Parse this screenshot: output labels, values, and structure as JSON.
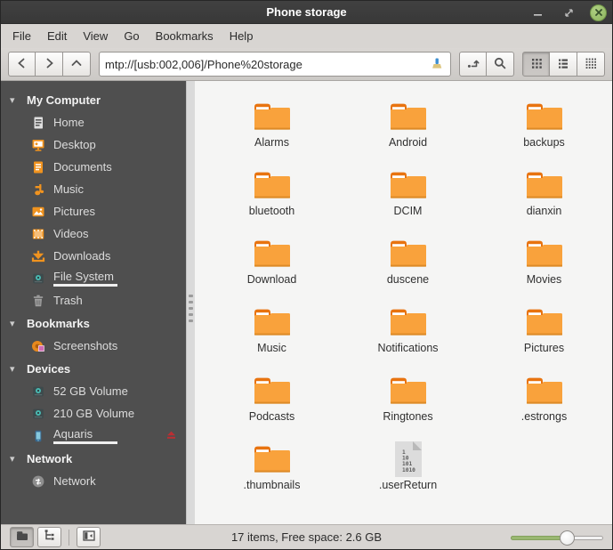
{
  "window": {
    "title": "Phone storage"
  },
  "titlebar": {
    "controls": [
      {
        "name": "minimize-button",
        "icon": "minimize-icon"
      },
      {
        "name": "restore-button",
        "icon": "restore-icon"
      },
      {
        "name": "close-button",
        "icon": "close-icon"
      }
    ]
  },
  "menubar": {
    "items": [
      "File",
      "Edit",
      "View",
      "Go",
      "Bookmarks",
      "Help"
    ]
  },
  "toolbar": {
    "nav_buttons": [
      {
        "name": "back-button",
        "icon": "chevron-left-icon"
      },
      {
        "name": "forward-button",
        "icon": "chevron-right-icon"
      },
      {
        "name": "up-button",
        "icon": "chevron-up-icon"
      }
    ],
    "location_value": "mtp://[usb:002,006]/Phone%20storage",
    "entry_icon": "clear-location-brush-icon",
    "action_buttons": [
      {
        "name": "toggle-location-entry-button",
        "icon": "edit-location-icon"
      },
      {
        "name": "search-button",
        "icon": "search-icon"
      }
    ],
    "view_buttons": [
      {
        "name": "icon-view-button",
        "icon": "grid-view-icon",
        "active": true
      },
      {
        "name": "list-view-button",
        "icon": "list-view-icon",
        "active": false
      },
      {
        "name": "compact-view-button",
        "icon": "compact-view-icon",
        "active": false
      }
    ]
  },
  "sidebar": {
    "sections": [
      {
        "label": "My Computer",
        "items": [
          {
            "label": "Home",
            "icon": "home-document-icon"
          },
          {
            "label": "Desktop",
            "icon": "desktop-icon"
          },
          {
            "label": "Documents",
            "icon": "documents-icon"
          },
          {
            "label": "Music",
            "icon": "music-icon"
          },
          {
            "label": "Pictures",
            "icon": "pictures-icon"
          },
          {
            "label": "Videos",
            "icon": "videos-icon"
          },
          {
            "label": "Downloads",
            "icon": "downloads-icon"
          },
          {
            "label": "File System",
            "icon": "drive-icon",
            "usage_fill_percent": 27
          },
          {
            "label": "Trash",
            "icon": "trash-icon"
          }
        ]
      },
      {
        "label": "Bookmarks",
        "items": [
          {
            "label": "Screenshots",
            "icon": "screenshots-folder-icon"
          }
        ]
      },
      {
        "label": "Devices",
        "items": [
          {
            "label": "52 GB Volume",
            "icon": "drive-icon"
          },
          {
            "label": "210 GB Volume",
            "icon": "drive-icon"
          },
          {
            "label": "Aquaris",
            "icon": "phone-icon",
            "usage_fill_percent": 0,
            "eject": true
          }
        ]
      },
      {
        "label": "Network",
        "items": [
          {
            "label": "Network",
            "icon": "network-icon"
          }
        ]
      }
    ]
  },
  "main": {
    "items": [
      {
        "label": "Alarms",
        "icon": "folder-icon"
      },
      {
        "label": "Android",
        "icon": "folder-icon"
      },
      {
        "label": "backups",
        "icon": "folder-icon"
      },
      {
        "label": "bluetooth",
        "icon": "folder-icon"
      },
      {
        "label": "DCIM",
        "icon": "folder-icon"
      },
      {
        "label": "dianxin",
        "icon": "folder-icon"
      },
      {
        "label": "Download",
        "icon": "folder-icon"
      },
      {
        "label": "duscene",
        "icon": "folder-icon"
      },
      {
        "label": "Movies",
        "icon": "folder-icon"
      },
      {
        "label": "Music",
        "icon": "folder-icon"
      },
      {
        "label": "Notifications",
        "icon": "folder-icon"
      },
      {
        "label": "Pictures",
        "icon": "folder-icon"
      },
      {
        "label": "Podcasts",
        "icon": "folder-icon"
      },
      {
        "label": "Ringtones",
        "icon": "folder-icon"
      },
      {
        "label": ".estrongs",
        "icon": "folder-icon"
      },
      {
        "label": ".thumbnails",
        "icon": "folder-icon"
      },
      {
        "label": ".userReturn",
        "icon": "binary-file-icon",
        "file_icon_text": [
          "1",
          "10",
          "101",
          "1010"
        ]
      }
    ]
  },
  "statusbar": {
    "buttons": [
      {
        "name": "places-toggle-button",
        "icon": "places-icon",
        "active": true
      },
      {
        "name": "treeview-toggle-button",
        "icon": "treeview-icon",
        "active": false
      },
      {
        "name": "hide-sidebar-button",
        "icon": "hide-sidebar-icon",
        "active": false
      }
    ],
    "status_text": "17 items, Free space: 2.6 GB",
    "zoom_slider_percent": 62
  },
  "colors": {
    "accent_orange": "#f9a23c",
    "folder_tab_orange": "#e8730f",
    "sidebar_bg": "#4f4f4f",
    "titlebar_bg": "#3a3a3a",
    "close_button_green": "#8db45e",
    "usage_green": "#8fb36a",
    "eject_red": "#bb2f33",
    "main_bg": "#f5f5f4"
  }
}
